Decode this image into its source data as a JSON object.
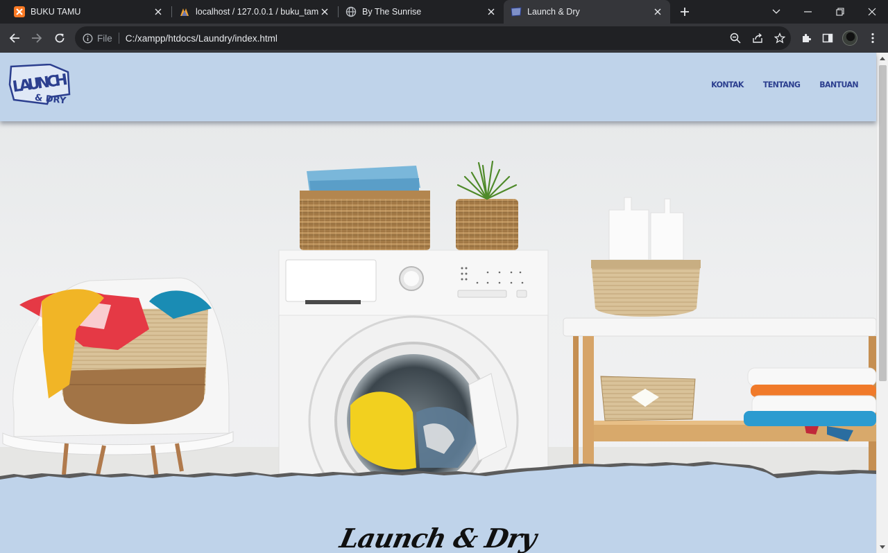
{
  "browser": {
    "tabs": [
      {
        "title": "BUKU TAMU",
        "icon": "xampp-icon",
        "active": false
      },
      {
        "title": "localhost / 127.0.0.1 / buku_tamu",
        "icon": "phpmyadmin-icon",
        "active": false
      },
      {
        "title": "By The Sunrise",
        "icon": "globe-icon",
        "active": false
      },
      {
        "title": "Launch & Dry",
        "icon": "launch-dry-icon",
        "active": true
      }
    ],
    "omnibox": {
      "scheme": "File",
      "url": "C:/xampp/htdocs/Laundry/index.html"
    },
    "colors": {
      "frame": "#202124",
      "toolbar": "#35363a"
    }
  },
  "site": {
    "logo": {
      "line1": "LAUNCH",
      "line2": "& DRY"
    },
    "nav": {
      "kontak": "KONTAK",
      "tentang": "TENTANG",
      "bantuan": "BANTUAN"
    },
    "brand_script": "Launch & Dry",
    "colors": {
      "background": "#bfd3ea",
      "nav_text": "#2c3f8f"
    }
  }
}
